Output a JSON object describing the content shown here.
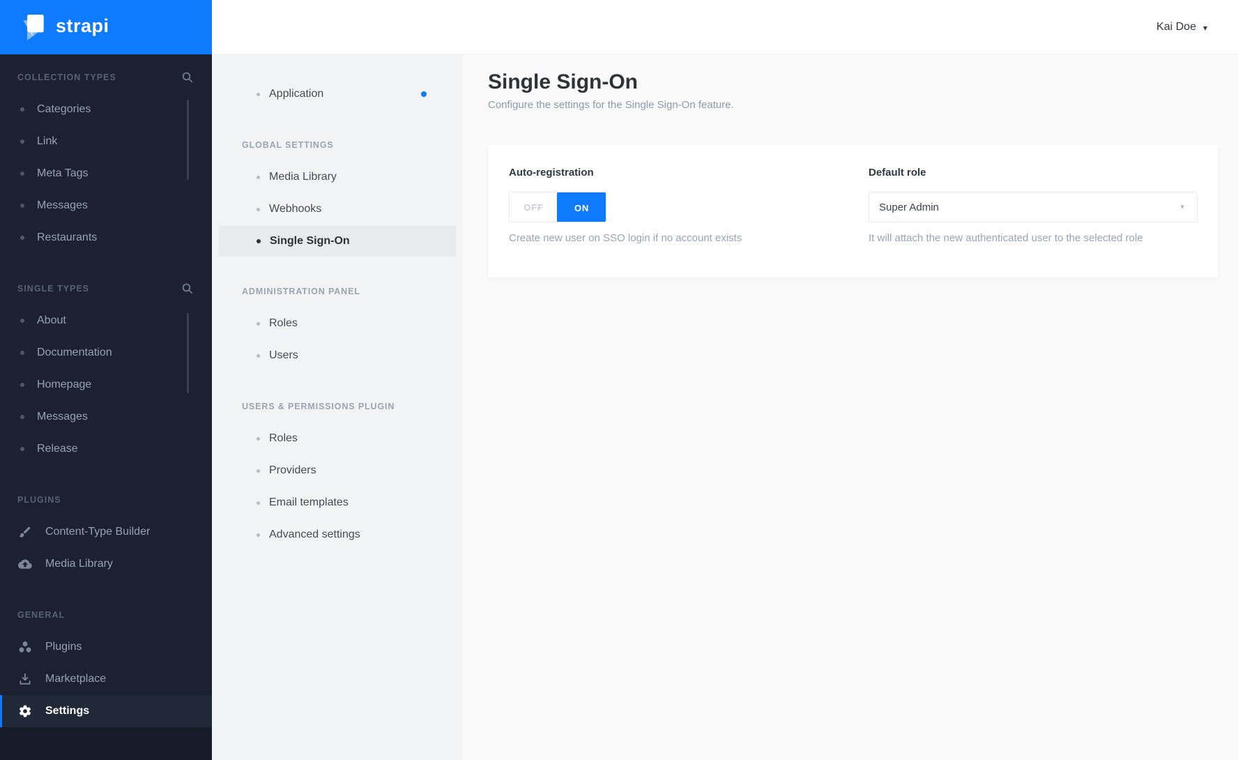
{
  "brand": {
    "name": "strapi"
  },
  "header": {
    "user_name": "Kai Doe"
  },
  "left_sidebar": {
    "sections": [
      {
        "header": "COLLECTION TYPES",
        "items": [
          "Categories",
          "Link",
          "Meta Tags",
          "Messages",
          "Restaurants"
        ]
      },
      {
        "header": "SINGLE TYPES",
        "items": [
          "About",
          "Documentation",
          "Homepage",
          "Messages",
          "Release"
        ]
      },
      {
        "header": "PLUGINS",
        "items": [
          "Content-Type Builder",
          "Media Library"
        ]
      },
      {
        "header": "GENERAL",
        "items": [
          "Plugins",
          "Marketplace",
          "Settings"
        ]
      }
    ]
  },
  "settings_nav": {
    "application_label": "Application",
    "sections": [
      {
        "header": "GLOBAL SETTINGS",
        "items": [
          "Media Library",
          "Webhooks",
          "Single Sign-On"
        ]
      },
      {
        "header": "ADMINISTRATION PANEL",
        "items": [
          "Roles",
          "Users"
        ]
      },
      {
        "header": "USERS & PERMISSIONS PLUGIN",
        "items": [
          "Roles",
          "Providers",
          "Email templates",
          "Advanced settings"
        ]
      }
    ]
  },
  "page": {
    "title": "Single Sign-On",
    "subtitle": "Configure the settings for the Single Sign-On feature."
  },
  "form": {
    "auto_registration": {
      "label": "Auto-registration",
      "off_label": "OFF",
      "on_label": "ON",
      "selected": "ON",
      "help": "Create new user on SSO login if no account exists"
    },
    "default_role": {
      "label": "Default role",
      "value": "Super Admin",
      "help": "It will attach the new authenticated user to the selected role"
    }
  },
  "colors": {
    "accent": "#0e7aff",
    "sidebar_bg": "#1b2130",
    "sidebar_footer_bg": "#171c29",
    "subnav_bg": "#f2f3f4",
    "main_bg": "#fafafb"
  }
}
